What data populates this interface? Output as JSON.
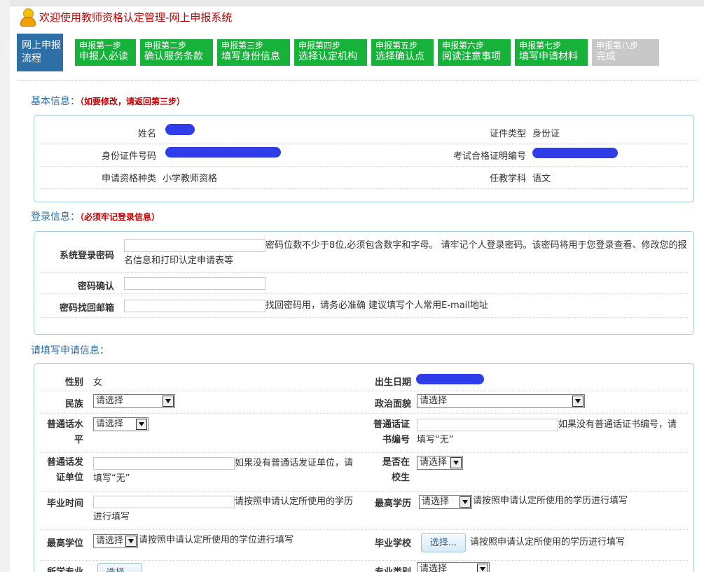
{
  "header": {
    "title": "欢迎使用教师资格认定管理-网上申报系统"
  },
  "steps": {
    "label": "网上申报流程",
    "items": [
      {
        "l1": "申报第一步",
        "l2": "申报人必读",
        "state": "done"
      },
      {
        "l1": "申报第二步",
        "l2": "确认服务条款",
        "state": "done"
      },
      {
        "l1": "申报第三步",
        "l2": "填写身份信息",
        "state": "done"
      },
      {
        "l1": "申报第四步",
        "l2": "选择认定机构",
        "state": "done"
      },
      {
        "l1": "申报第五步",
        "l2": "选择确认点",
        "state": "done"
      },
      {
        "l1": "申报第六步",
        "l2": "阅读注意事项",
        "state": "done"
      },
      {
        "l1": "申报第七步",
        "l2": "填写申请材料",
        "state": "done"
      },
      {
        "l1": "申报第八步",
        "l2": "完成",
        "state": "todo"
      }
    ]
  },
  "basic": {
    "title": "基本信息：",
    "note": "（如要修改，请返回第三步）",
    "name_label": "姓名",
    "id_type_label": "证件类型",
    "id_type_value": "身份证",
    "id_no_label": "身份证件号码",
    "exam_no_label": "考试合格证明编号",
    "qual_label": "申请资格种类",
    "qual_value": "小学教师资格",
    "subject_label": "任教学科",
    "subject_value": "语文"
  },
  "login": {
    "title": "登录信息：",
    "note": "（必须牢记登录信息）",
    "password_label": "系统登录密码",
    "password_value": "",
    "password_hint": "密码位数不少于8位,必须包含数字和字母。 请牢记个人登录密码。该密码将用于您登录查看、修改您的报名信息和打印认定申请表等",
    "confirm_label": "密码确认",
    "confirm_value": "",
    "email_label": "密码找回邮箱",
    "email_value": "",
    "email_hint": "找回密码用，请务必准确 建议填写个人常用E-mail地址"
  },
  "apply": {
    "title": "请填写申请信息：",
    "gender_label": "性别",
    "gender_value": "女",
    "birth_label": "出生日期",
    "ethnic_label": "民族",
    "ethnic_value": "请选择",
    "political_label": "政治面貌",
    "political_value": "请选择",
    "mandarin_level_label": "普通话水平",
    "mandarin_level_value": "请选择",
    "mandarin_cert_label": "普通话证书编号",
    "mandarin_cert_value": "",
    "mandarin_cert_hint": "如果没有普通话证书编号，请填写“无”",
    "mandarin_org_label": "普通话发证单位",
    "mandarin_org_value": "",
    "mandarin_org_hint": "如果没有普通话发证单位，请填写“无”",
    "in_school_label": "是否在校生",
    "in_school_value": "请选择",
    "grad_time_label": "毕业时间",
    "grad_time_value": "",
    "grad_time_hint": "请按照申请认定所使用的学历进行填写",
    "edu_label": "最高学历",
    "edu_value": "请选择",
    "edu_hint": "请按照申请认定所使用的学历进行填写",
    "degree_label": "最高学位",
    "degree_value": "请选择",
    "degree_hint": "请按照申请认定所使用的学位进行填写",
    "school_label": "毕业学校",
    "school_button": "选择...",
    "school_hint": "请按照申请认定所使用的学历进行填写",
    "major_label": "所学专业",
    "major_type_label": "专业类别",
    "major_type_value": "请选择"
  },
  "colors": {
    "accent_blue": "#2e6fa6",
    "step_green": "#17b23a",
    "step_gray": "#c8c8c8",
    "note_red": "#c00000",
    "redact_blue": "#2d3ee8"
  }
}
